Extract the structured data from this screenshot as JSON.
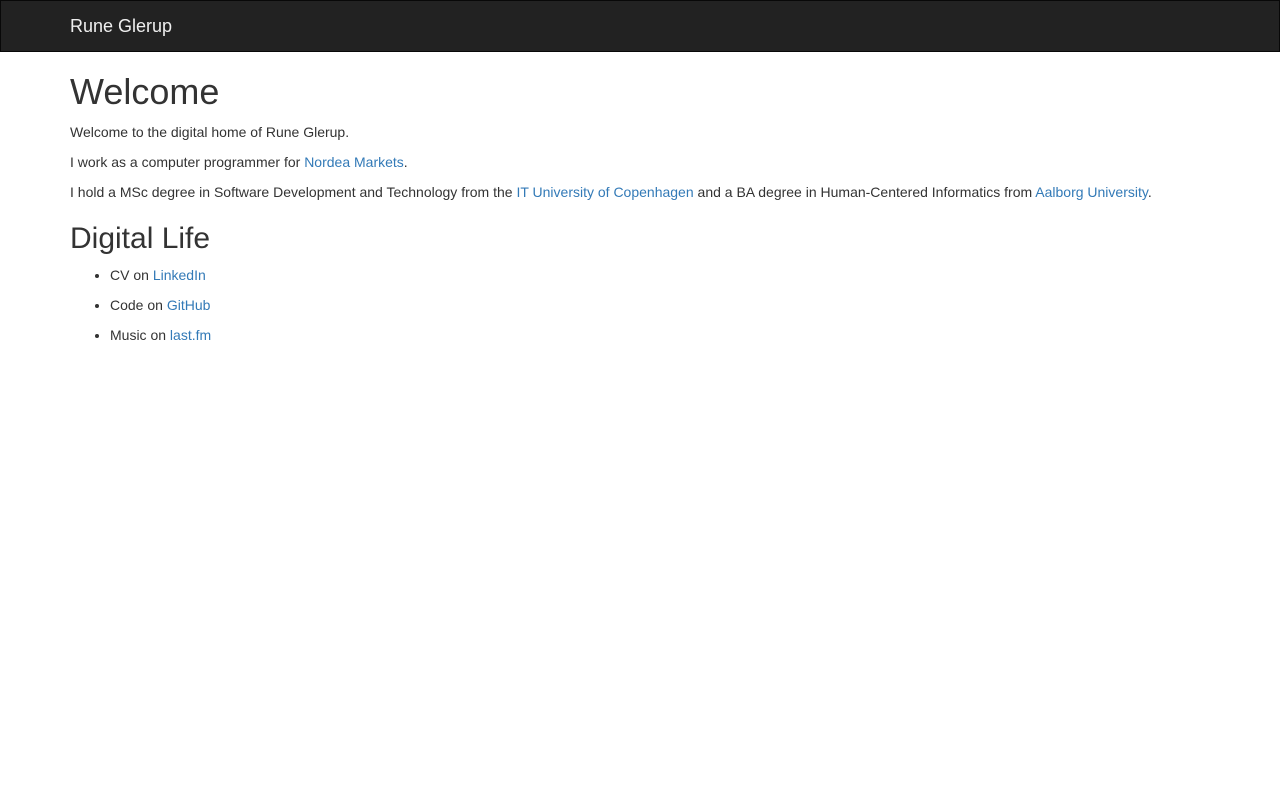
{
  "colors": {
    "navbar_bg": "#222222",
    "navbar_border": "#080808",
    "brand_text": "#eeeeee",
    "link": "#337ab7",
    "body_text": "#333333"
  },
  "navbar": {
    "brand": "Rune Glerup"
  },
  "main": {
    "welcome": {
      "heading": "Welcome",
      "p1": "Welcome to the digital home of Rune Glerup.",
      "p2_prefix": "I work as a computer programmer for ",
      "p2_link": "Nordea Markets",
      "p2_suffix": ".",
      "p3_prefix": "I hold a MSc degree in Software Development and Technology from the ",
      "p3_link1": "IT University of Copenhagen",
      "p3_mid": " and a BA degree in Human-Centered Informatics from ",
      "p3_link2": "Aalborg University",
      "p3_suffix": "."
    },
    "digital_life": {
      "heading": "Digital Life",
      "items": [
        {
          "prefix": "CV on ",
          "link": "LinkedIn"
        },
        {
          "prefix": "Code on ",
          "link": "GitHub"
        },
        {
          "prefix": "Music on ",
          "link": "last.fm"
        }
      ]
    }
  }
}
